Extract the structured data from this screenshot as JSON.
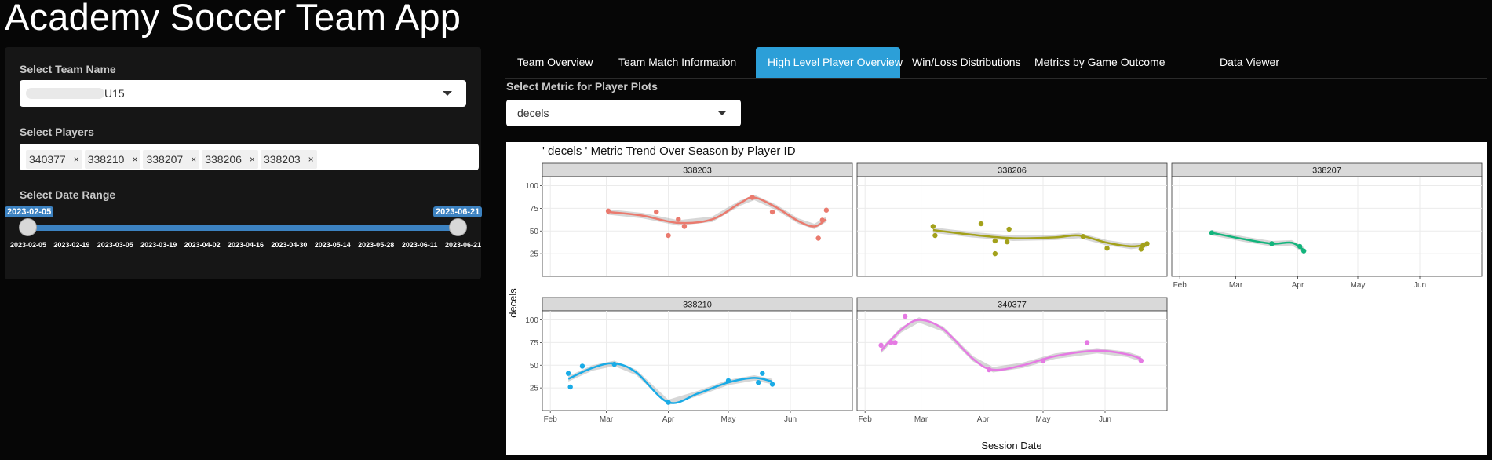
{
  "app": {
    "title": "Academy Soccer Team App"
  },
  "sidebar": {
    "team_label": "Select Team Name",
    "team_value": "U15",
    "players_label": "Select Players",
    "players": [
      "340377",
      "338210",
      "338207",
      "338206",
      "338203"
    ],
    "remove_glyph": "×",
    "date_label": "Select Date Range",
    "date_start": "2023-02-05",
    "date_end": "2023-06-21",
    "date_ticks": [
      "2023-02-05",
      "2023-02-19",
      "2023-03-05",
      "2023-03-19",
      "2023-04-02",
      "2023-04-16",
      "2023-04-30",
      "2023-05-14",
      "2023-05-28",
      "2023-06-11",
      "2023-06-21"
    ]
  },
  "tabs": [
    "Team Overview",
    "Team Match Information",
    "High Level Player Overview",
    "Win/Loss Distributions",
    "Metrics by Game Outcome",
    "Data Viewer"
  ],
  "active_tab": "High Level Player Overview",
  "metric": {
    "label": "Select Metric for Player Plots",
    "value": "decels"
  },
  "colors": {
    "accent": "#2c9fd8",
    "slider": "#3c82c1",
    "strip": "#d9d9d9"
  },
  "chart_data": {
    "type": "scatter",
    "title": "' decels ' Metric Trend Over Season by Player ID",
    "xlabel": "Session Date",
    "ylabel": "decels",
    "x_ticks": [
      "Feb",
      "Mar",
      "Apr",
      "May",
      "Jun"
    ],
    "y_ticks": [
      25,
      50,
      75,
      100
    ],
    "ylim": [
      0,
      110
    ],
    "facets": [
      {
        "name": "338203",
        "color": "#ea7a6e",
        "points": [
          [
            "2023-03-02",
            72
          ],
          [
            "2023-03-26",
            71
          ],
          [
            "2023-04-01",
            45
          ],
          [
            "2023-04-06",
            63
          ],
          [
            "2023-04-09",
            55
          ],
          [
            "2023-05-13",
            87
          ],
          [
            "2023-05-23",
            71
          ],
          [
            "2023-06-15",
            42
          ],
          [
            "2023-06-17",
            62
          ],
          [
            "2023-06-19",
            73
          ]
        ],
        "trend": [
          [
            "2023-03-02",
            71
          ],
          [
            "2023-03-19",
            67
          ],
          [
            "2023-04-06",
            59
          ],
          [
            "2023-04-23",
            63
          ],
          [
            "2023-05-07",
            81
          ],
          [
            "2023-05-14",
            87
          ],
          [
            "2023-05-25",
            76
          ],
          [
            "2023-06-05",
            61
          ],
          [
            "2023-06-13",
            55
          ],
          [
            "2023-06-19",
            63
          ]
        ]
      },
      {
        "name": "338206",
        "color": "#a3a11b",
        "points": [
          [
            "2023-03-07",
            55
          ],
          [
            "2023-03-08",
            45
          ],
          [
            "2023-03-31",
            58
          ],
          [
            "2023-04-07",
            25
          ],
          [
            "2023-04-07",
            39
          ],
          [
            "2023-04-13",
            38
          ],
          [
            "2023-04-14",
            52
          ],
          [
            "2023-05-21",
            44
          ],
          [
            "2023-06-02",
            31
          ],
          [
            "2023-06-19",
            30
          ],
          [
            "2023-06-20",
            34
          ],
          [
            "2023-06-22",
            36
          ]
        ],
        "trend": [
          [
            "2023-03-07",
            51
          ],
          [
            "2023-03-26",
            46
          ],
          [
            "2023-04-16",
            42
          ],
          [
            "2023-05-07",
            43
          ],
          [
            "2023-05-19",
            45
          ],
          [
            "2023-06-02",
            37
          ],
          [
            "2023-06-14",
            33
          ],
          [
            "2023-06-22",
            35
          ]
        ]
      },
      {
        "name": "338207",
        "color": "#13b47c",
        "points": [
          [
            "2023-02-17",
            48
          ],
          [
            "2023-03-19",
            36
          ],
          [
            "2023-04-02",
            33
          ],
          [
            "2023-04-04",
            28
          ]
        ],
        "trend": [
          [
            "2023-02-17",
            48
          ],
          [
            "2023-03-05",
            41
          ],
          [
            "2023-03-19",
            36
          ],
          [
            "2023-03-29",
            37
          ],
          [
            "2023-04-04",
            29
          ]
        ]
      },
      {
        "name": "338210",
        "color": "#1aabe6",
        "points": [
          [
            "2023-02-10",
            41
          ],
          [
            "2023-02-11",
            26
          ],
          [
            "2023-02-17",
            49
          ],
          [
            "2023-03-05",
            51
          ],
          [
            "2023-04-01",
            9
          ],
          [
            "2023-05-01",
            33
          ],
          [
            "2023-05-16",
            31
          ],
          [
            "2023-05-18",
            41
          ],
          [
            "2023-05-23",
            29
          ]
        ],
        "trend": [
          [
            "2023-02-10",
            35
          ],
          [
            "2023-02-22",
            47
          ],
          [
            "2023-03-05",
            52
          ],
          [
            "2023-03-16",
            42
          ],
          [
            "2023-04-01",
            9
          ],
          [
            "2023-04-16",
            19
          ],
          [
            "2023-05-01",
            31
          ],
          [
            "2023-05-14",
            36
          ],
          [
            "2023-05-23",
            32
          ]
        ]
      },
      {
        "name": "340377",
        "color": "#e57ae3",
        "points": [
          [
            "2023-02-09",
            72
          ],
          [
            "2023-02-14",
            75
          ],
          [
            "2023-02-16",
            75
          ],
          [
            "2023-02-21",
            104
          ],
          [
            "2023-04-04",
            45
          ],
          [
            "2023-05-01",
            55
          ],
          [
            "2023-05-23",
            75
          ],
          [
            "2023-06-19",
            55
          ]
        ],
        "trend": [
          [
            "2023-02-09",
            66
          ],
          [
            "2023-02-19",
            89
          ],
          [
            "2023-02-28",
            100
          ],
          [
            "2023-03-12",
            90
          ],
          [
            "2023-03-27",
            57
          ],
          [
            "2023-04-06",
            45
          ],
          [
            "2023-04-21",
            50
          ],
          [
            "2023-05-07",
            60
          ],
          [
            "2023-05-28",
            66
          ],
          [
            "2023-06-12",
            62
          ],
          [
            "2023-06-19",
            57
          ]
        ]
      }
    ]
  }
}
